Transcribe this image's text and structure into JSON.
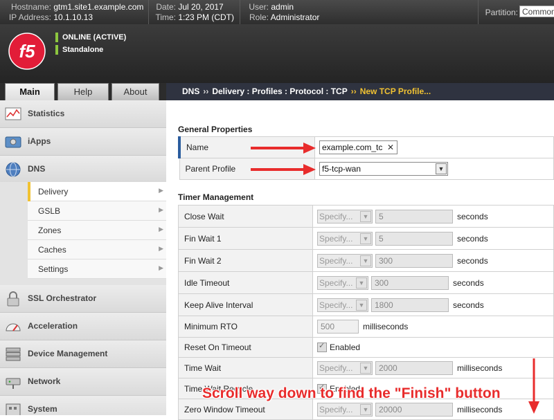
{
  "topbar": {
    "hostname_label": "Hostname:",
    "hostname": "gtm1.site1.example.com",
    "ip_label": "IP Address:",
    "ip": "10.1.10.13",
    "date_label": "Date:",
    "date": "Jul 20, 2017",
    "time_label": "Time:",
    "time": "1:23 PM (CDT)",
    "user_label": "User:",
    "user": "admin",
    "role_label": "Role:",
    "role": "Administrator",
    "partition_label": "Partition:",
    "partition": "Common"
  },
  "header": {
    "logo_text": "f5",
    "status": "ONLINE (ACTIVE)",
    "mode": "Standalone",
    "status_color": "#8dc63f"
  },
  "tabs": [
    {
      "label": "Main",
      "active": true
    },
    {
      "label": "Help",
      "active": false
    },
    {
      "label": "About",
      "active": false
    }
  ],
  "breadcrumb": {
    "items": [
      "DNS",
      "Delivery : Profiles : Protocol : TCP"
    ],
    "separator": "››",
    "current": "New TCP Profile..."
  },
  "sidebar": {
    "sections": [
      {
        "label": "Statistics",
        "icon": "statistics-icon"
      },
      {
        "label": "iApps",
        "icon": "iapps-icon"
      },
      {
        "label": "DNS",
        "icon": "globe-icon"
      },
      {
        "label": "SSL Orchestrator",
        "icon": "lock-icon"
      },
      {
        "label": "Acceleration",
        "icon": "speedometer-icon"
      },
      {
        "label": "Device Management",
        "icon": "server-icon"
      },
      {
        "label": "Network",
        "icon": "network-icon"
      },
      {
        "label": "System",
        "icon": "system-icon"
      }
    ],
    "dns_subitems": [
      "Delivery",
      "GSLB",
      "Zones",
      "Caches",
      "Settings"
    ],
    "selected_subitem": "Delivery"
  },
  "general": {
    "title": "General Properties",
    "name_label": "Name",
    "name_value": "example.com_tc",
    "parent_label": "Parent Profile",
    "parent_value": "f5-tcp-wan"
  },
  "timer": {
    "title": "Timer Management",
    "specify": "Specify...",
    "rows": [
      {
        "label": "Close Wait",
        "value": "5",
        "unit": "seconds"
      },
      {
        "label": "Fin Wait 1",
        "value": "5",
        "unit": "seconds"
      },
      {
        "label": "Fin Wait 2",
        "value": "300",
        "unit": "seconds"
      },
      {
        "label": "Idle Timeout",
        "value": "300",
        "unit": "seconds"
      },
      {
        "label": "Keep Alive Interval",
        "value": "1800",
        "unit": "seconds"
      },
      {
        "label": "Minimum RTO",
        "value": "500",
        "unit": "milliseconds"
      },
      {
        "label": "Reset On Timeout",
        "checkbox_label": "Enabled"
      },
      {
        "label": "Time Wait",
        "value": "2000",
        "unit": "milliseconds"
      },
      {
        "label": "Time Wait Recycle",
        "checkbox_label": "Enabled"
      },
      {
        "label": "Zero Window Timeout",
        "value": "20000",
        "unit": "milliseconds"
      }
    ]
  },
  "annotation": {
    "text": "Scroll way down to find the \"Finish\" button",
    "color": "#e82c2c"
  }
}
